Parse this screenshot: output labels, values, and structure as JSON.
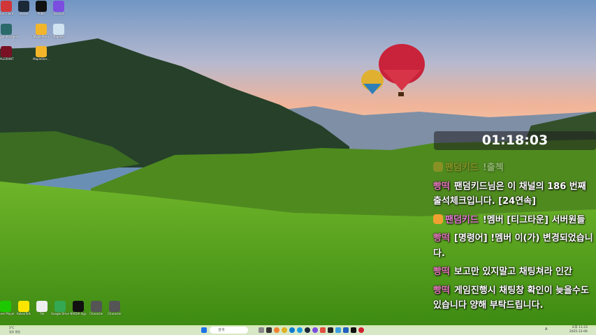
{
  "desktop": {
    "icons": [
      {
        "label": "Riot Client",
        "color": "#d13639"
      },
      {
        "label": "Steam",
        "color": "#1b2838"
      },
      {
        "label": "PUBG",
        "color": "#111111"
      },
      {
        "label": "Discord",
        "color": "#7b4de0"
      },
      {
        "label": "League of Legends",
        "color": "#2b6a6a"
      },
      {
        "label": "MapleStory",
        "color": "#f3b52a"
      },
      {
        "label": "MapleAI",
        "color": "#cfe3f0"
      },
      {
        "label": "VALORANT",
        "color": "#7a1024"
      },
      {
        "label": "MapleStor...",
        "color": "#f3b52a"
      }
    ],
    "bottom_icons": [
      {
        "label": "Naver Player",
        "color": "#1ec800"
      },
      {
        "label": "KakaoTalk",
        "color": "#fee500"
      },
      {
        "label": "File",
        "color": "#eeeeee"
      },
      {
        "label": "Google Drive",
        "color": "#34a853"
      },
      {
        "label": "NVIDIA App",
        "color": "#111111"
      },
      {
        "label": "Character",
        "color": "#555555"
      },
      {
        "label": "Character",
        "color": "#555555"
      }
    ]
  },
  "timer": "01:18:03",
  "chat": [
    {
      "nick": "팬덤키드",
      "nick_color": "#f0a030",
      "text": "!출첵",
      "faded": true,
      "badge": true
    },
    {
      "nick": "빵떡",
      "nick_color": "#e07ab8",
      "text": "팬덤키드님은 이 채널의 186 번째 출석체크입니다. [24연속]"
    },
    {
      "nick": "팬덤키드",
      "nick_color": "#e87ad8",
      "text": "!멤버 [티그타운] 서버원들",
      "badge": true
    },
    {
      "nick": "빵떡",
      "nick_color": "#e07ab8",
      "text": "[명령어] !멤버 이(가) 변경되었습니다."
    },
    {
      "nick": "빵떡",
      "nick_color": "#e07ab8",
      "text": "보고만 있지말고 채팅쳐라 인간"
    },
    {
      "nick": "빵떡",
      "nick_color": "#e07ab8",
      "text": "게임진행시 채팅창 확인이 늦을수도 있습니다 양해 부탁드립니다."
    }
  ],
  "taskbar": {
    "search_placeholder": "검색",
    "weather_temp": "3°C",
    "weather_desc": "일부 맑음",
    "time": "오후 11:23",
    "date": "2025-12-06",
    "lang": "A"
  }
}
